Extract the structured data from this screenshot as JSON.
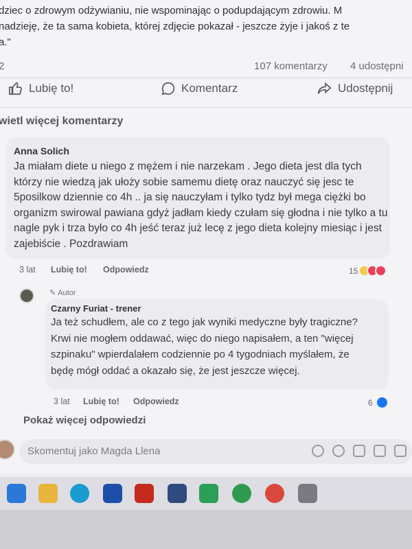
{
  "post": {
    "lines": [
      "dziec o zdrowym odżywianiu, nie wspominając o podupdającym zdrowiu. M",
      "nadzieję, że ta sama kobieta, której zdjęcie pokazał - jeszcze żyje i jakoś z te",
      "a.\""
    ]
  },
  "stats": {
    "left": "2",
    "comments": "107 komentarzy",
    "shares": "4 udostępni"
  },
  "actions": {
    "like": "Lubię to!",
    "comment": "Komentarz",
    "share": "Udostępnij"
  },
  "more_comments": "wietl więcej komentarzy",
  "comment": {
    "author": "Anna Solich",
    "body": "Ja miałam diete u niego z mężem i nie narzekam . Jego dieta jest dla tych którzy nie wiedzą jak ułoży sobie samemu dietę oraz nauczyć się jesc te 5posilkow dziennie co 4h .. ja się nauczyłam i tylko tydz był mega ciężki bo organizm swirowal pawiana gdyż jadłam kiedy czułam się głodna i nie tylko a tu nagle pyk i trza było co 4h jeść teraz już lecę z jego dieta kolejny miesiąc i jest zajebiście . Pozdrawiam",
    "time": "3 lat",
    "like": "Lubię to!",
    "reply": "Odpowiedz",
    "reactions_count": "15"
  },
  "reply": {
    "badge": "Autor",
    "author": "Czarny Furiat - trener",
    "body": "Ja też schudłem, ale co z tego jak wyniki medyczne były tragiczne? Krwi nie mogłem oddawać, więc do niego napisałem, a ten \"więcej szpinaku\" wpierdalałem codziennie po 4 tygodniach myślałem, że będę mógł oddać a okazało się, że jest jeszcze więcej.",
    "time": "3 lat",
    "like": "Lubię to!",
    "reply": "Odpowiedz",
    "reactions_count": "6"
  },
  "show_more_replies": "Pokaż więcej odpowiedzi",
  "composer": {
    "placeholder": "Skomentuj jako Magda Llena"
  },
  "colors": {
    "like_blue": "#1877f2",
    "haha_yellow": "#f7c948",
    "love_red": "#e8415a"
  },
  "taskbar": {
    "icons": [
      "people-icon",
      "folder-icon",
      "edge-icon",
      "store-icon",
      "mail-icon",
      "dropbox-icon",
      "drive-icon",
      "whatsapp-icon",
      "chrome-icon",
      "notepad-icon"
    ]
  }
}
